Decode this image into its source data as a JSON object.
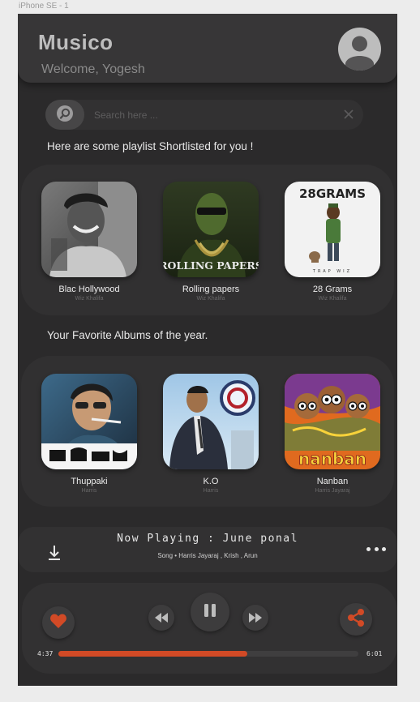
{
  "frame_label": "iPhone SE - 1",
  "header": {
    "title": "Musico",
    "welcome": "Welcome, Yogesh",
    "avatar_icon": "user-avatar-icon"
  },
  "search": {
    "placeholder": "Search here ...",
    "value": "",
    "search_icon": "search-icon",
    "clear_icon": "close-icon"
  },
  "playlists": {
    "heading": "Here are some playlist Shortlisted for you !",
    "items": [
      {
        "title": "Blac Hollywood",
        "artist": "Wiz Khalifa"
      },
      {
        "title": "Rolling papers",
        "artist": "Wiz Khalifa"
      },
      {
        "title": "28 Grams",
        "artist": "Wiz Khalifa"
      }
    ]
  },
  "albums": {
    "heading": "Your Favorite Albums of the year.",
    "items": [
      {
        "title": "Thuppaki",
        "artist": "Harris"
      },
      {
        "title": "K.O",
        "artist": "Harris"
      },
      {
        "title": "Nanban",
        "artist": "Harris Jayaraj"
      }
    ]
  },
  "cover_art_text": {
    "rolling": "ROLLING PAPERS",
    "grams": "28GRAMS",
    "grams_sub": "TRAP WIZ",
    "nanban": "nanban"
  },
  "now_playing": {
    "title": "Now Playing :  June ponal",
    "subtitle": "Song • Harris Jayaraj , Krish , Arun",
    "download_icon": "download-icon",
    "more_icon": "more-options-icon"
  },
  "player": {
    "elapsed": "4:37",
    "duration": "6:01",
    "progress": 0.63,
    "like_icon": "heart-icon",
    "prev_icon": "rewind-icon",
    "pause_icon": "pause-icon",
    "next_icon": "fast-forward-icon",
    "share_icon": "share-icon"
  },
  "colors": {
    "accent": "#d24a26",
    "background": "#2b2a2b",
    "surface": "#323132"
  }
}
